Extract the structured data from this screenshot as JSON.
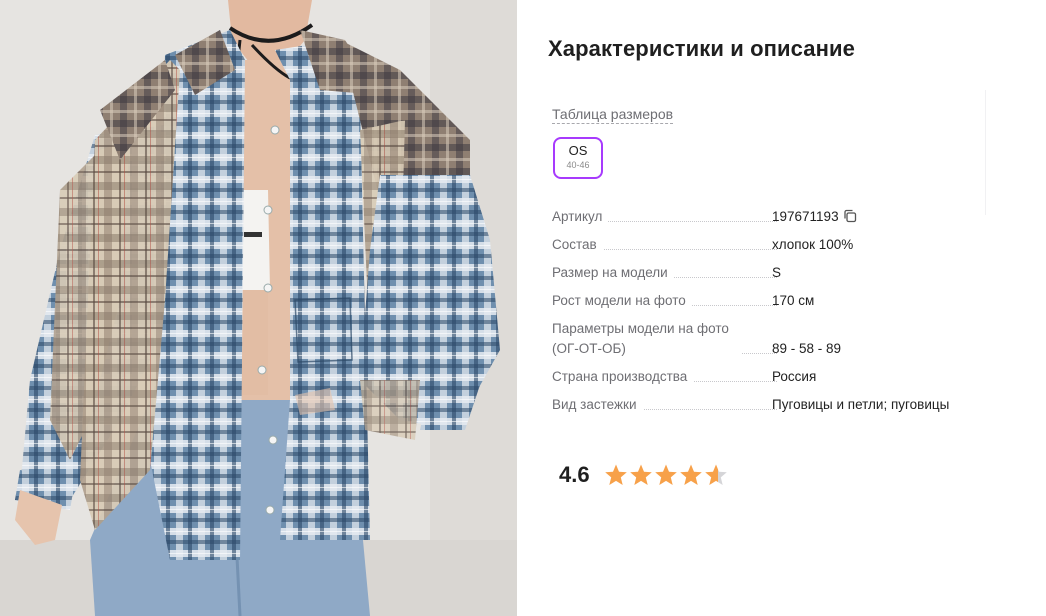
{
  "panel": {
    "title": "Характеристики и описание",
    "size_table_link": "Таблица размеров",
    "size_chip": {
      "label": "OS",
      "range": "40-46",
      "accent_color": "#a73afd"
    }
  },
  "specs": [
    {
      "name": "Артикул",
      "value": "197671193",
      "has_copy_icon": true
    },
    {
      "name": "Состав",
      "value": "хлопок 100%"
    },
    {
      "name": "Размер на модели",
      "value": "S"
    },
    {
      "name": "Рост модели на фото",
      "value": "170 см"
    },
    {
      "name_line1": "Параметры модели на фото",
      "name_line2": "(ОГ-ОТ-ОБ)",
      "value": "89 - 58 - 89"
    },
    {
      "name": "Страна производства",
      "value": "Россия"
    },
    {
      "name": "Вид застежки",
      "value": "Пуговицы и петли; пуговицы"
    }
  ],
  "rating": {
    "value": "4.6",
    "score": 4.6,
    "max": 5,
    "star_color": "#f7a14a",
    "star_empty_color": "#d5d5d8"
  },
  "icons": {
    "copy": "copy-icon",
    "star": "star-icon"
  }
}
